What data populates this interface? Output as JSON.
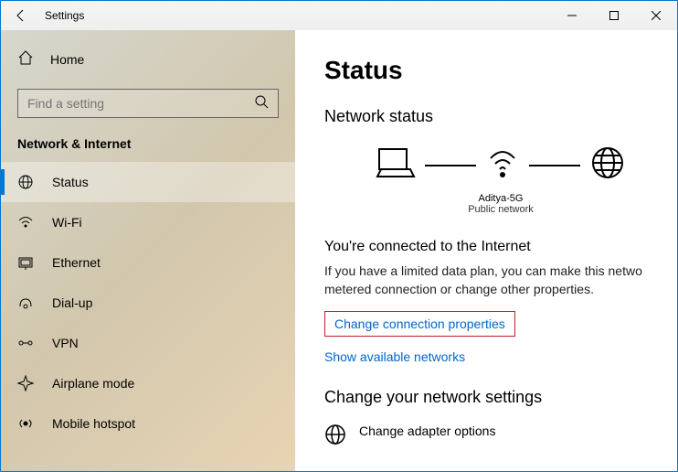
{
  "titlebar": {
    "title": "Settings"
  },
  "sidebar": {
    "home_label": "Home",
    "search_placeholder": "Find a setting",
    "category": "Network & Internet",
    "items": [
      {
        "label": "Status"
      },
      {
        "label": "Wi-Fi"
      },
      {
        "label": "Ethernet"
      },
      {
        "label": "Dial-up"
      },
      {
        "label": "VPN"
      },
      {
        "label": "Airplane mode"
      },
      {
        "label": "Mobile hotspot"
      }
    ]
  },
  "main": {
    "page_title": "Status",
    "network_status_heading": "Network status",
    "network_name": "Aditya-5G",
    "network_type": "Public network",
    "connected_heading": "You're connected to the Internet",
    "connected_desc": "If you have a limited data plan, you can make this netwo metered connection or change other properties.",
    "change_properties_link": "Change connection properties",
    "show_networks_link": "Show available networks",
    "change_settings_heading": "Change your network settings",
    "adapter_options_label": "Change adapter options"
  }
}
